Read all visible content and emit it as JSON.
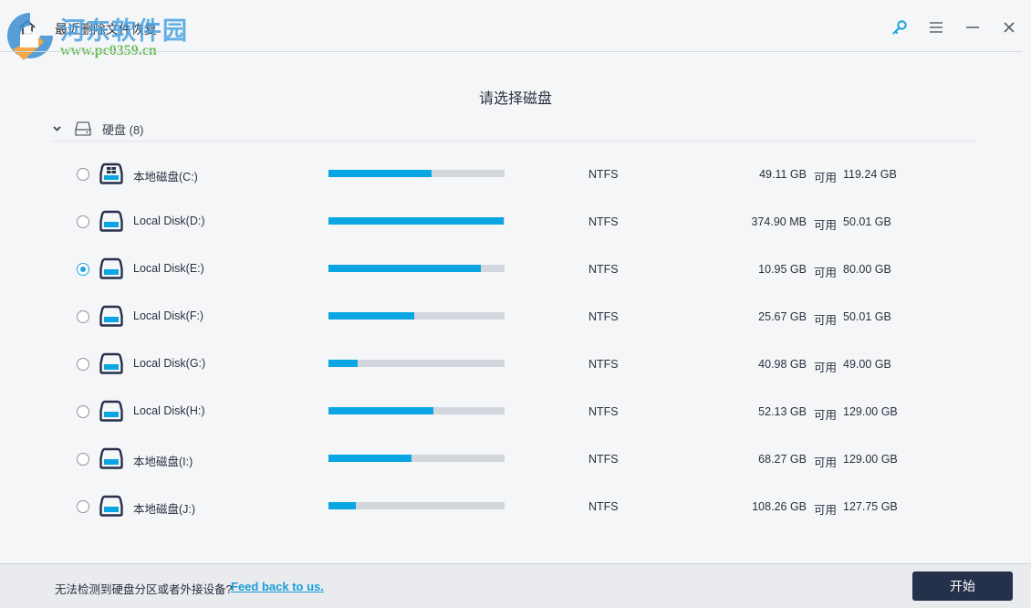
{
  "titlebar": {
    "app_title": "最近删除文件恢复",
    "icons": {
      "home": "home-icon",
      "key": "key-icon",
      "menu": "menu-icon",
      "minimize": "minimize-icon",
      "close": "close-icon"
    }
  },
  "watermark": {
    "site_name": "河东软件园",
    "url": "www.pc0359.cn"
  },
  "main": {
    "heading": "请选择磁盘",
    "group": {
      "label": "硬盘 (8)",
      "expanded": true
    },
    "disks": [
      {
        "name": "本地磁盘(C:)",
        "type": "system",
        "selected": false,
        "used_fraction": 0.588,
        "fs": "NTFS",
        "free": "49.11 GB",
        "avail_label": "可用",
        "total": "119.24 GB"
      },
      {
        "name": "Local Disk(D:)",
        "type": "data",
        "selected": false,
        "used_fraction": 0.993,
        "fs": "NTFS",
        "free": "374.90 MB",
        "avail_label": "可用",
        "total": "50.01 GB"
      },
      {
        "name": "Local Disk(E:)",
        "type": "data",
        "selected": true,
        "used_fraction": 0.863,
        "fs": "NTFS",
        "free": "10.95 GB",
        "avail_label": "可用",
        "total": "80.00 GB"
      },
      {
        "name": "Local Disk(F:)",
        "type": "data",
        "selected": false,
        "used_fraction": 0.487,
        "fs": "NTFS",
        "free": "25.67 GB",
        "avail_label": "可用",
        "total": "50.01 GB"
      },
      {
        "name": "Local Disk(G:)",
        "type": "data",
        "selected": false,
        "used_fraction": 0.164,
        "fs": "NTFS",
        "free": "40.98 GB",
        "avail_label": "可用",
        "total": "49.00 GB"
      },
      {
        "name": "Local Disk(H:)",
        "type": "data",
        "selected": false,
        "used_fraction": 0.596,
        "fs": "NTFS",
        "free": "52.13 GB",
        "avail_label": "可用",
        "total": "129.00 GB"
      },
      {
        "name": "本地磁盘(I:)",
        "type": "data",
        "selected": false,
        "used_fraction": 0.471,
        "fs": "NTFS",
        "free": "68.27 GB",
        "avail_label": "可用",
        "total": "129.00 GB"
      },
      {
        "name": "本地磁盘(J:)",
        "type": "data",
        "selected": false,
        "used_fraction": 0.153,
        "fs": "NTFS",
        "free": "108.26 GB",
        "avail_label": "可用",
        "total": "127.75 GB"
      }
    ]
  },
  "footer": {
    "message": "无法检测到硬盘分区或者外接设备?",
    "link_label": "Feed back to us.",
    "start_label": "开始"
  },
  "colors": {
    "accent": "#0aa6e3",
    "bar_track": "#d3d6dc",
    "primary_button": "#25304a",
    "link": "#1a9fd9"
  }
}
